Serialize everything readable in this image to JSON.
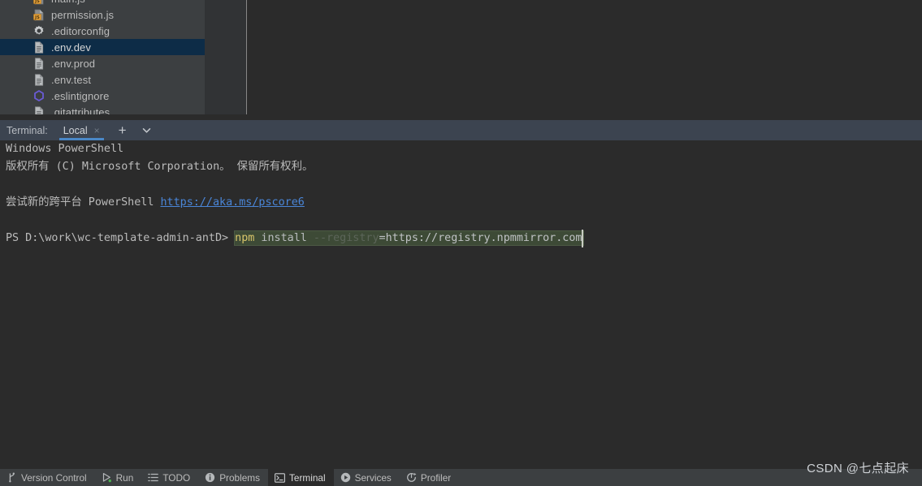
{
  "project_tree": {
    "rows": [
      {
        "label": "main.js",
        "icon": "js-file-icon",
        "selected": false,
        "clipped": true
      },
      {
        "label": "permission.js",
        "icon": "js-file-icon",
        "selected": false,
        "clipped": false
      },
      {
        "label": ".editorconfig",
        "icon": "gear-icon",
        "selected": false,
        "clipped": false
      },
      {
        "label": ".env.dev",
        "icon": "text-file-icon",
        "selected": true,
        "clipped": false
      },
      {
        "label": ".env.prod",
        "icon": "text-file-icon",
        "selected": false,
        "clipped": false
      },
      {
        "label": ".env.test",
        "icon": "text-file-icon",
        "selected": false,
        "clipped": false
      },
      {
        "label": ".eslintignore",
        "icon": "eslint-icon",
        "selected": false,
        "clipped": false
      },
      {
        "label": ".gitattributes",
        "icon": "text-file-icon",
        "selected": false,
        "clipped": false
      }
    ]
  },
  "terminal": {
    "toolwindow_label": "Terminal:",
    "tab": {
      "name": "Local",
      "close_glyph": "×"
    },
    "add_glyph": "+",
    "lines": [
      {
        "type": "text",
        "text": "Windows PowerShell"
      },
      {
        "type": "text",
        "text": "版权所有 (C) Microsoft Corporation。 保留所有权利。"
      },
      {
        "type": "blank",
        "text": ""
      },
      {
        "type": "link_line",
        "prefix": "尝试新的跨平台 PowerShell ",
        "link": "https://aka.ms/pscore6"
      },
      {
        "type": "blank",
        "text": ""
      },
      {
        "type": "prompt",
        "text": ""
      }
    ],
    "prompt": {
      "prefix": "PS D:\\work\\wc-template-admin-antD> ",
      "command_keyword": "npm",
      "command_sub": " install ",
      "command_dim": "--registry",
      "command_value": "=https://registry.npmmirror.com"
    }
  },
  "statusbar": {
    "items": [
      {
        "label": "Version Control",
        "icon": "branch-icon",
        "active": false
      },
      {
        "label": "Run",
        "icon": "play-icon",
        "active": false
      },
      {
        "label": "TODO",
        "icon": "list-icon",
        "active": false
      },
      {
        "label": "Problems",
        "icon": "info-icon",
        "active": false
      },
      {
        "label": "Terminal",
        "icon": "terminal-icon",
        "active": true
      },
      {
        "label": "Services",
        "icon": "play-circle-icon",
        "active": false
      },
      {
        "label": "Profiler",
        "icon": "profiler-icon",
        "active": false
      }
    ]
  },
  "watermark": {
    "text": "CSDN @七点起床"
  },
  "colors": {
    "panel_bg": "#3c3f41",
    "editor_bg": "#2b2b2b",
    "tab_bar_bg": "#3c4450",
    "selection_bg": "#0d2c47",
    "accent_blue": "#4a88c7",
    "link_blue": "#4a86d8",
    "cmd_highlight_bg": "#3d4a36",
    "cmd_keyword": "#d8c56b"
  }
}
